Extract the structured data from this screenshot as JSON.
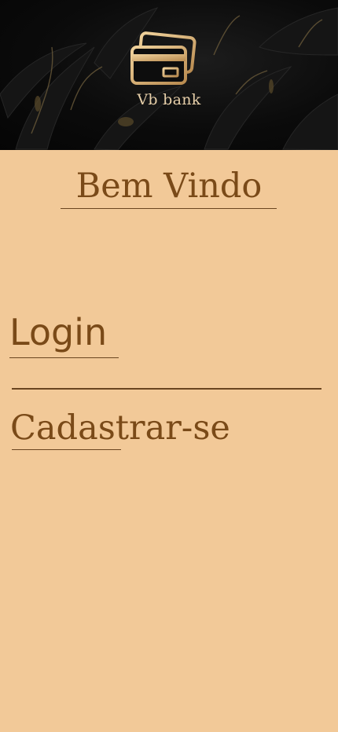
{
  "header": {
    "brand_name": "Vb bank",
    "logo_icon": "credit-cards-icon",
    "accent": "#d9b078",
    "background": "#0b0b0b"
  },
  "main": {
    "welcome_title": "Bem Vindo",
    "login_label": "Login",
    "signup_label": "Cadastrar-se",
    "text_color": "#7a4a18",
    "background": "#f2c998"
  }
}
